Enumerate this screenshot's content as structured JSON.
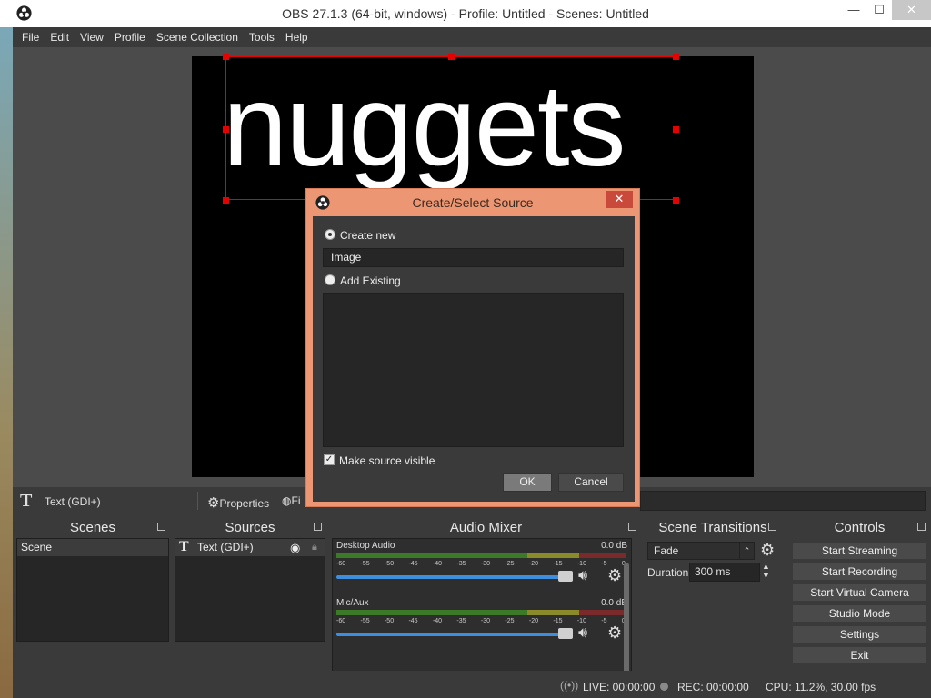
{
  "window": {
    "title": "OBS 27.1.3 (64-bit, windows) - Profile: Untitled - Scenes: Untitled",
    "min_glyph": "—",
    "max_glyph": "☐",
    "close_glyph": "✕"
  },
  "menu": [
    "File",
    "Edit",
    "View",
    "Profile",
    "Scene Collection",
    "Tools",
    "Help"
  ],
  "preview": {
    "text": "nuggets"
  },
  "context_bar": {
    "source_name": "Text (GDI+)",
    "properties_label": "Properties",
    "filters_label": "Fi"
  },
  "scenes": {
    "title": "Scenes",
    "items": [
      "Scene"
    ]
  },
  "sources": {
    "title": "Sources",
    "items": [
      "Text (GDI+)"
    ]
  },
  "mixer": {
    "title": "Audio Mixer",
    "scale": [
      "-60",
      "-55",
      "-50",
      "-45",
      "-40",
      "-35",
      "-30",
      "-25",
      "-20",
      "-15",
      "-10",
      "-5",
      "0"
    ],
    "tracks": [
      {
        "name": "Desktop Audio",
        "db": "0.0 dB"
      },
      {
        "name": "Mic/Aux",
        "db": "0.0 dB"
      }
    ]
  },
  "transitions": {
    "title": "Scene Transitions",
    "selected": "Fade",
    "duration_label": "Duration",
    "duration_value": "300 ms"
  },
  "controls": {
    "title": "Controls",
    "buttons": [
      "Start Streaming",
      "Start Recording",
      "Start Virtual Camera",
      "Studio Mode",
      "Settings",
      "Exit"
    ]
  },
  "status": {
    "live": "LIVE: 00:00:00",
    "rec": "REC: 00:00:00",
    "cpu": "CPU: 11.2%, 30.00 fps"
  },
  "dialog": {
    "title": "Create/Select Source",
    "create_new_label": "Create new",
    "name_value": "Image",
    "add_existing_label": "Add Existing",
    "visible_label": "Make source visible",
    "ok_label": "OK",
    "cancel_label": "Cancel"
  },
  "colors": {
    "dialog_frame": "#ec9673",
    "selection": "#e60000",
    "slider": "#3e8ee0"
  }
}
